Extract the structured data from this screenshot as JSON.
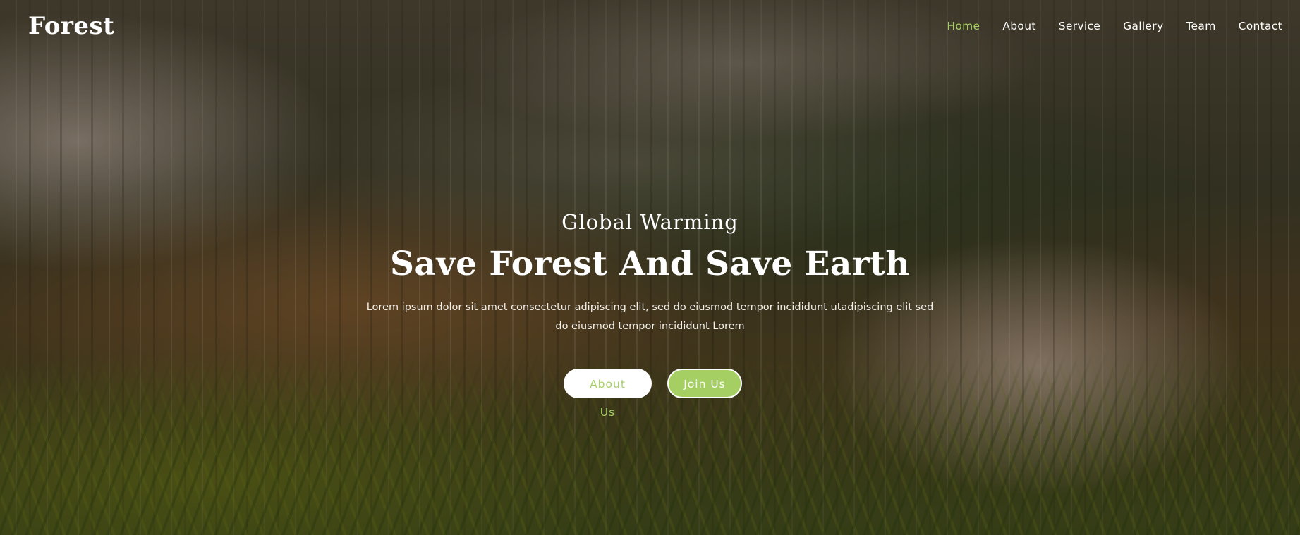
{
  "brand": {
    "logo_text": "Forest"
  },
  "nav": {
    "items": [
      {
        "label": "Home",
        "active": true
      },
      {
        "label": "About"
      },
      {
        "label": "Service"
      },
      {
        "label": "Gallery"
      },
      {
        "label": "Team"
      },
      {
        "label": "Contact"
      }
    ]
  },
  "hero": {
    "subtitle": "Global Warming",
    "title": "Save Forest And Save Earth",
    "description": "Lorem ipsum dolor sit amet consectetur adipiscing elit, sed do eiusmod tempor incididunt utadipiscing elit sed do eiusmod tempor incididunt Lorem",
    "primary_button": "About Us",
    "secondary_button": "Join Us"
  },
  "colors": {
    "accent": "#a5cf62",
    "text": "#ffffff"
  }
}
